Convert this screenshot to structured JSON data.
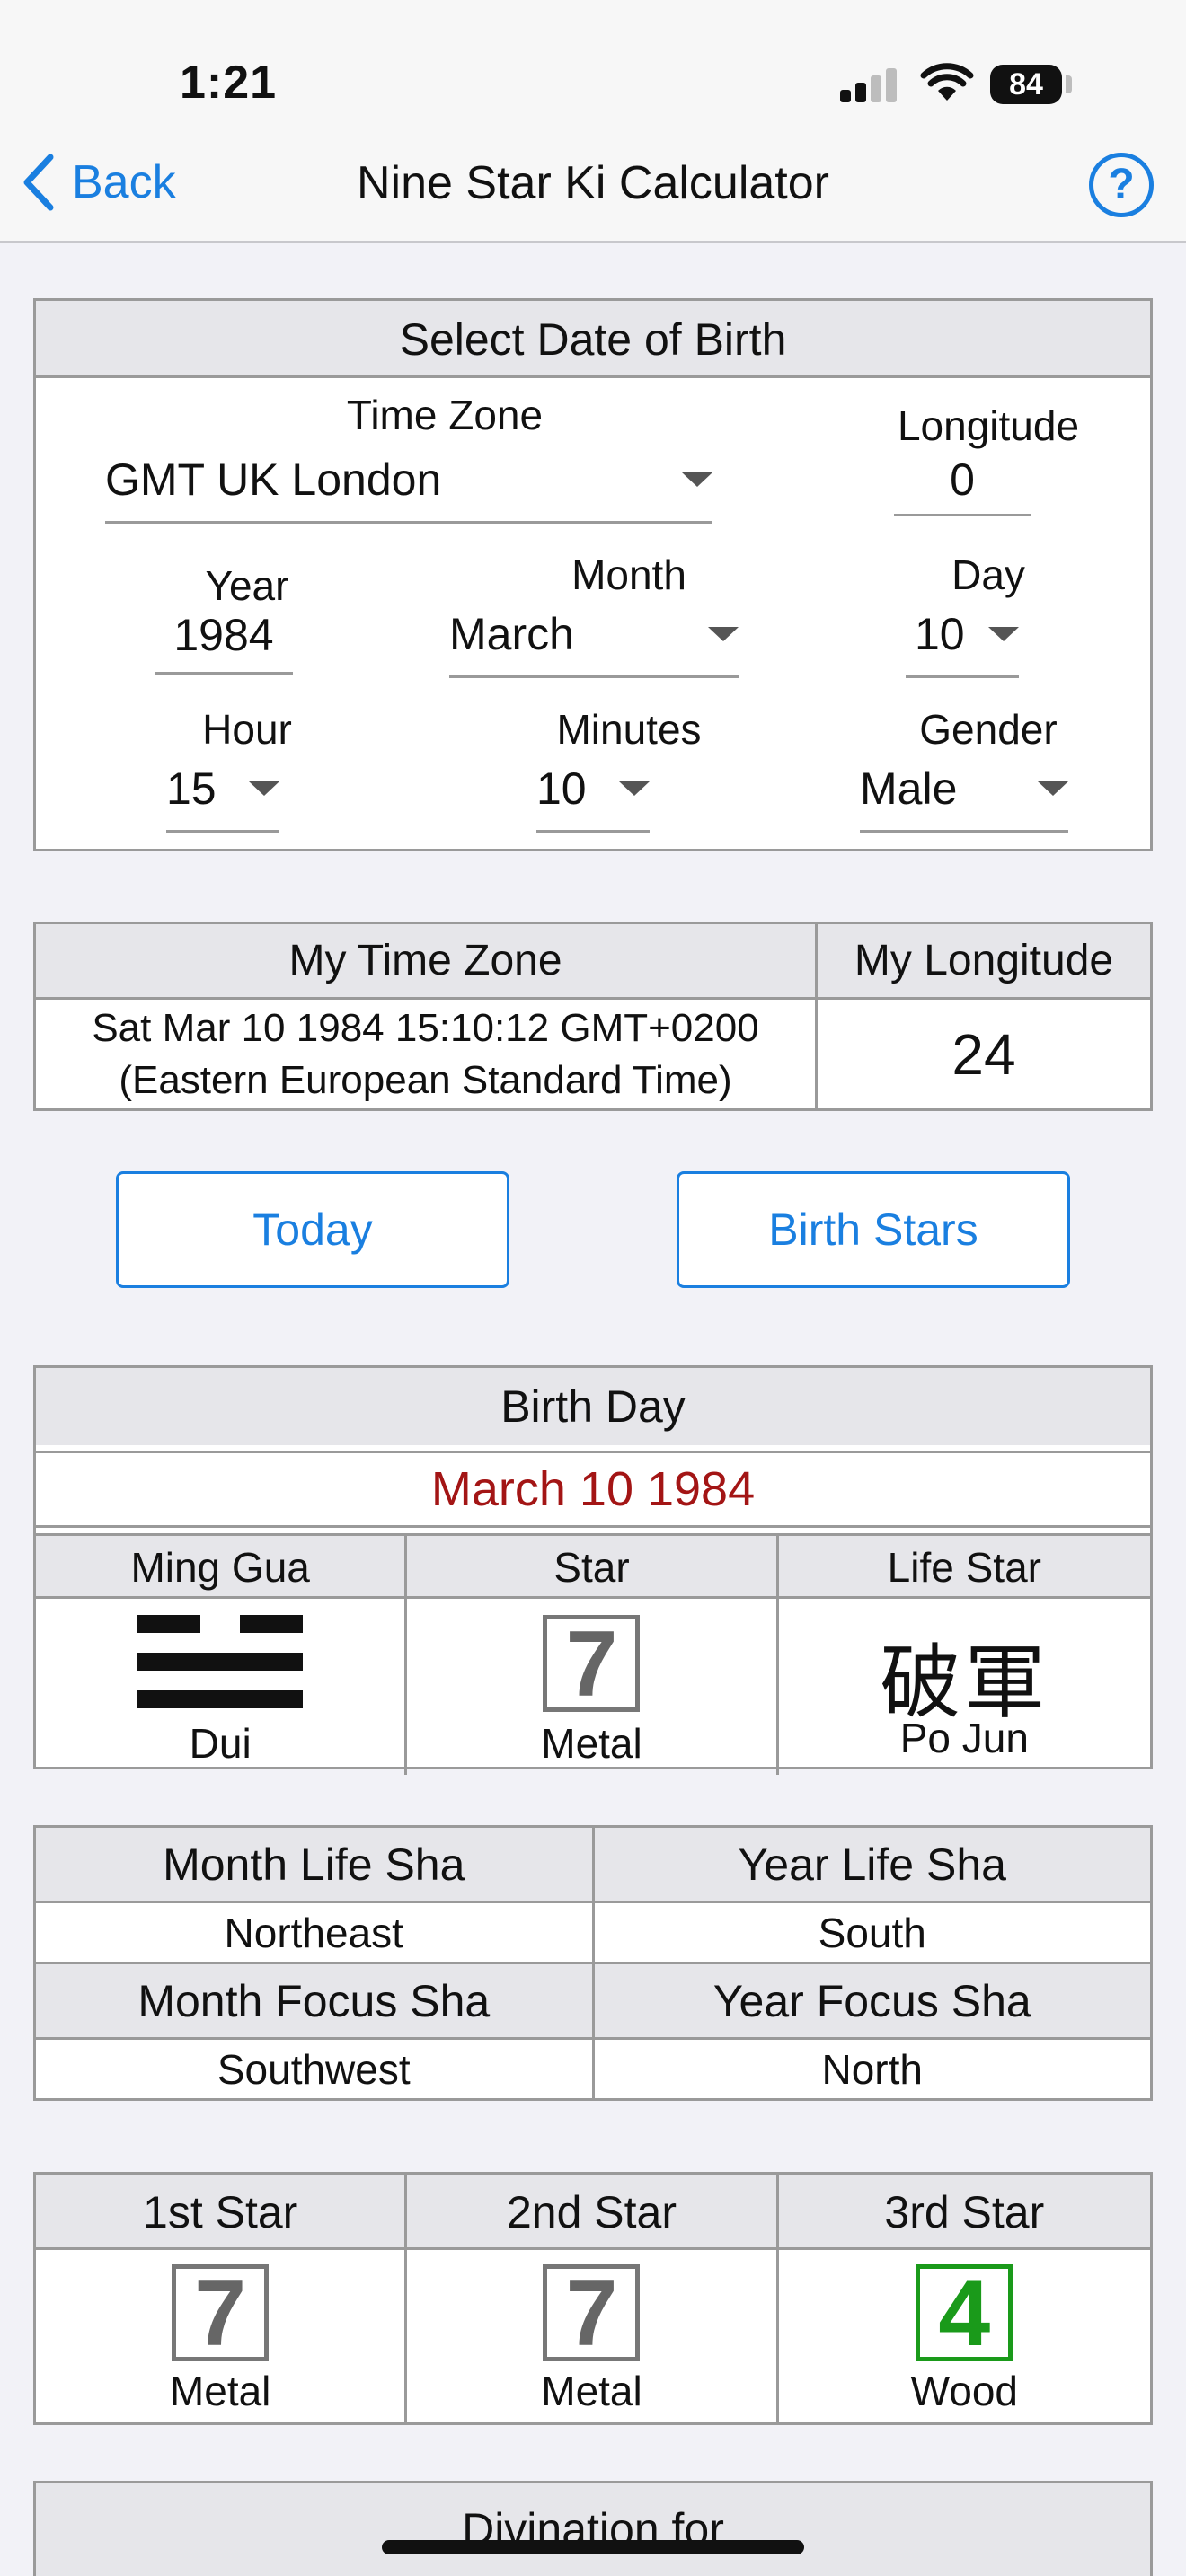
{
  "status": {
    "time": "1:21",
    "battery": "84"
  },
  "nav": {
    "back_label": "Back",
    "title": "Nine Star Ki Calculator",
    "help_label": "?"
  },
  "dob": {
    "header": "Select Date of Birth",
    "timezone_label": "Time Zone",
    "timezone_value": "GMT UK London",
    "longitude_label": "Longitude",
    "longitude_value": "0",
    "year_label": "Year",
    "year_value": "1984",
    "month_label": "Month",
    "month_value": "March",
    "day_label": "Day",
    "day_value": "10",
    "hour_label": "Hour",
    "hour_value": "15",
    "minutes_label": "Minutes",
    "minutes_value": "10",
    "gender_label": "Gender",
    "gender_value": "Male"
  },
  "mytz": {
    "tz_header": "My Time Zone",
    "lon_header": "My Longitude",
    "tz_line1": "Sat Mar 10 1984 15:10:12 GMT+0200",
    "tz_line2": "(Eastern European Standard Time)",
    "lon_value": "24"
  },
  "buttons": {
    "today": "Today",
    "birth_stars": "Birth Stars"
  },
  "birthday": {
    "header": "Birth Day",
    "date": "March 10 1984",
    "col1": "Ming Gua",
    "col2": "Star",
    "col3": "Life Star",
    "gua_name": "Dui",
    "star_number": "7",
    "star_element": "Metal",
    "life_star_chinese": "破軍",
    "life_star_name": "Po Jun"
  },
  "sha": {
    "month_life_label": "Month Life Sha",
    "year_life_label": "Year Life Sha",
    "month_life_value": "Northeast",
    "year_life_value": "South",
    "month_focus_label": "Month Focus Sha",
    "year_focus_label": "Year Focus Sha",
    "month_focus_value": "Southwest",
    "year_focus_value": "North"
  },
  "stars": {
    "h1": "1st Star",
    "h2": "2nd Star",
    "h3": "3rd Star",
    "s1_num": "7",
    "s1_el": "Metal",
    "s2_num": "7",
    "s2_el": "Metal",
    "s3_num": "4",
    "s3_el": "Wood"
  },
  "divination": {
    "header": "Divination for"
  },
  "colors": {
    "accent": "#1a7fe0",
    "date_red": "#a31515",
    "wood_green": "#1a9a1a"
  }
}
